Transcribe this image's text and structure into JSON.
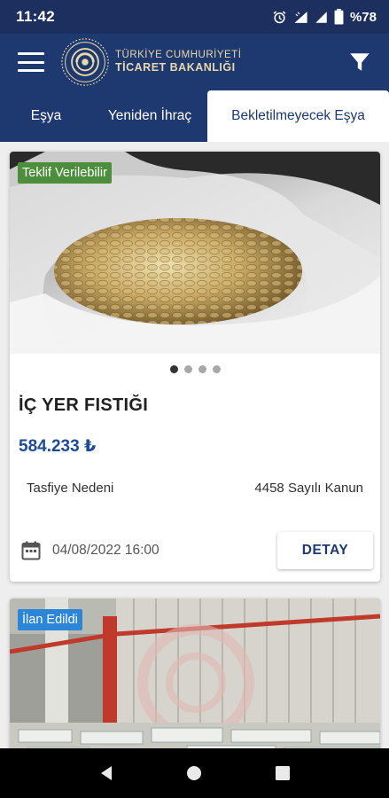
{
  "status_bar": {
    "time": "11:42",
    "battery": "%78",
    "icons": [
      "alarm-icon",
      "wifi-icon",
      "signal-icon",
      "battery-icon"
    ]
  },
  "header": {
    "logo_line1": "TÜRKİYE CUMHURİYETİ",
    "logo_line2": "TİCARET BAKANLIĞI",
    "menu_icon": "hamburger-menu-icon",
    "filter_icon": "filter-icon",
    "background": "#1e3870",
    "logo_color": "#e9d8a8"
  },
  "tabs": [
    {
      "label": "Eşya",
      "active": false
    },
    {
      "label": "Yeniden İhraç",
      "active": false
    },
    {
      "label": "Bekletilmeyecek Eşya",
      "active": true
    }
  ],
  "cards": [
    {
      "badge": "Teklif Verilebilir",
      "badge_color": "#4c8e3c",
      "image_slides": 4,
      "active_slide": 1,
      "title": "İÇ YER FISTIĞI",
      "price": "584.233 ₺",
      "reason_label": "Tasfiye Nedeni",
      "reason_value": "4458 Sayılı Kanun",
      "date": "04/08/2022 16:00",
      "detail_button": "DETAY"
    },
    {
      "badge": "İlan Edildi",
      "badge_color": "#2c86d8"
    }
  ],
  "nav_bar": {
    "icons": [
      "back-icon",
      "home-icon",
      "recents-icon"
    ]
  }
}
